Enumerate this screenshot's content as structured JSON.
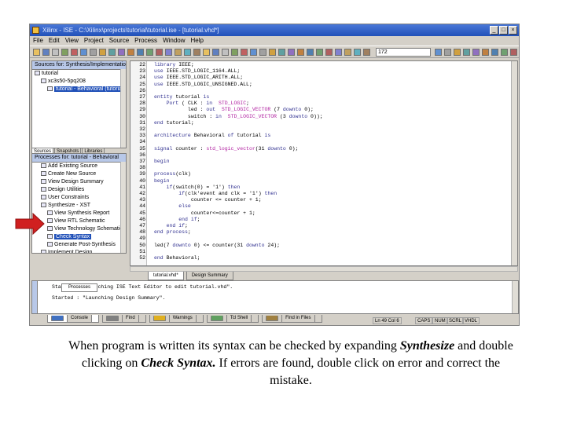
{
  "window": {
    "title": "Xilinx - ISE - C:\\Xilinx\\projects\\tutorial\\tutorial.ise - [tutorial.vhd*]",
    "buttons": {
      "minimize": "_",
      "maximize": "□",
      "close": "×"
    }
  },
  "menu": [
    "File",
    "Edit",
    "View",
    "Project",
    "Source",
    "Process",
    "Window",
    "Help"
  ],
  "toolbar": {
    "search_value": "172"
  },
  "sources_pane": {
    "header": "Sources for: Synthesis/Implementation",
    "items": [
      {
        "label": "tutorial",
        "indent": 0
      },
      {
        "label": "xc3s50-5pq208",
        "indent": 1
      },
      {
        "label": "tutorial - Behavioral (tutorial.vhd)",
        "indent": 2,
        "selected": true
      }
    ],
    "tabs": [
      "Sources",
      "Snapshots",
      "Libraries"
    ]
  },
  "processes_pane": {
    "header": "Processes for: tutorial - Behavioral",
    "items": [
      {
        "label": "Add Existing Source",
        "indent": 1
      },
      {
        "label": "Create New Source",
        "indent": 1
      },
      {
        "label": "View Design Summary",
        "indent": 1
      },
      {
        "label": "Design Utilities",
        "indent": 1
      },
      {
        "label": "User Constraints",
        "indent": 1
      },
      {
        "label": "Synthesize - XST",
        "indent": 1
      },
      {
        "label": "View Synthesis Report",
        "indent": 2
      },
      {
        "label": "View RTL Schematic",
        "indent": 2
      },
      {
        "label": "View Technology Schematic",
        "indent": 2
      },
      {
        "label": "Check Syntax",
        "indent": 2,
        "selected": true
      },
      {
        "label": "Generate Post-Synthesis",
        "indent": 2
      },
      {
        "label": "Implement Design",
        "indent": 1
      }
    ],
    "bottom_tab": "Processes"
  },
  "editor": {
    "lines": [
      {
        "n": "22",
        "code": "library IEEE;"
      },
      {
        "n": "23",
        "code": "use IEEE.STD_LOGIC_1164.ALL;"
      },
      {
        "n": "24",
        "code": "use IEEE.STD_LOGIC_ARITH.ALL;"
      },
      {
        "n": "25",
        "code": "use IEEE.STD_LOGIC_UNSIGNED.ALL;"
      },
      {
        "n": "26",
        "code": ""
      },
      {
        "n": "27",
        "code": "entity tutorial is"
      },
      {
        "n": "28",
        "code": "    Port ( CLK : in  STD_LOGIC;"
      },
      {
        "n": "29",
        "code": "           led : out  STD_LOGIC_VECTOR (7 downto 0);"
      },
      {
        "n": "30",
        "code": "           switch : in  STD_LOGIC_VECTOR (3 downto 0));"
      },
      {
        "n": "31",
        "code": "end tutorial;"
      },
      {
        "n": "32",
        "code": ""
      },
      {
        "n": "33",
        "code": "architecture Behavioral of tutorial is"
      },
      {
        "n": "34",
        "code": ""
      },
      {
        "n": "35",
        "code": "signal counter : std_logic_vector(31 downto 0);"
      },
      {
        "n": "36",
        "code": ""
      },
      {
        "n": "37",
        "code": "begin"
      },
      {
        "n": "38",
        "code": ""
      },
      {
        "n": "39",
        "code": "process(clk)"
      },
      {
        "n": "40",
        "code": "begin"
      },
      {
        "n": "41",
        "code": "    if(switch(0) = '1') then"
      },
      {
        "n": "42",
        "code": "        if(clk'event and clk = '1') then"
      },
      {
        "n": "43",
        "code": "            counter <= counter + 1;"
      },
      {
        "n": "44",
        "code": "        else"
      },
      {
        "n": "45",
        "code": "            counter<=counter + 1;"
      },
      {
        "n": "46",
        "code": "        end if;"
      },
      {
        "n": "47",
        "code": "    end if;"
      },
      {
        "n": "48",
        "code": "end process;"
      },
      {
        "n": "49",
        "code": ""
      },
      {
        "n": "50",
        "code": "led(7 downto 0) <= counter(31 downto 24);"
      },
      {
        "n": "51",
        "code": ""
      },
      {
        "n": "52",
        "code": "end Behavioral;"
      }
    ],
    "tabs": [
      "tutorial.vhd*",
      "Design Summary"
    ]
  },
  "console": {
    "lines": [
      "Started : \"Launching ISE Text Editor to edit tutorial.vhd\".",
      "Started : \"Launching Design Summary\"."
    ],
    "tabs": [
      "Console",
      "Find",
      "Warnings",
      "Tcl Shell",
      "Find in Files"
    ]
  },
  "status": {
    "cursor": "Ln 49 Col 6",
    "caps": "CAPS",
    "num": "NUM",
    "scrl": "SCRL",
    "lang": "VHDL"
  },
  "caption": {
    "part1": "When program is written its syntax can be checked by expanding ",
    "bold1": "Synthesize",
    "part2": " and double clicking on ",
    "bold2": "Check Syntax.",
    "part3": " If errors are found, double click on error and correct the mistake."
  },
  "colors": {
    "title_bar": "#2050b8",
    "selection": "#2050b8",
    "arrow": "#d02020",
    "keyword": "#303090",
    "type": "#b020a0"
  }
}
